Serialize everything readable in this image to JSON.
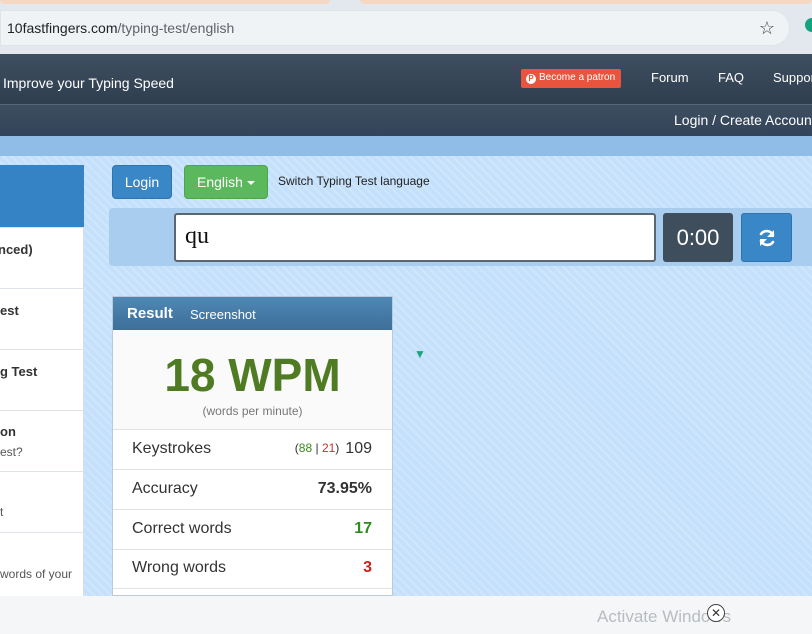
{
  "browser": {
    "url_domain": "10fastfingers.com",
    "url_path": "/typing-test/english",
    "star_icon": "☆"
  },
  "site": {
    "brand": "Improve your Typing Speed",
    "patron_label": "Become a patron",
    "nav": [
      "Forum",
      "FAQ",
      "Suppor"
    ],
    "login_create": "Login / Create Accoun"
  },
  "sidebar": {
    "items": [
      {
        "title": "nced)",
        "sub": ""
      },
      {
        "title": "est",
        "sub": ""
      },
      {
        "title": "g Test",
        "sub": ""
      },
      {
        "title": "on",
        "sub": "est?"
      },
      {
        "title": "",
        "sub": "t"
      },
      {
        "title": "",
        "sub": "words of your"
      }
    ]
  },
  "controls": {
    "login_label": "Login",
    "language_label": "English",
    "switch_text": "Switch Typing Test language",
    "input_value": "qu",
    "timer": "0:00"
  },
  "result": {
    "title": "Result",
    "screenshot": "Screenshot",
    "wpm": "18 WPM",
    "wpm_sub": "(words per minute)",
    "keystrokes_label": "Keystrokes",
    "keystrokes_correct": "88",
    "keystrokes_sep": "|",
    "keystrokes_wrong": "21",
    "keystrokes_total": "109",
    "accuracy_label": "Accuracy",
    "accuracy_value": "73.95%",
    "correct_label": "Correct words",
    "correct_value": "17",
    "wrong_label": "Wrong words",
    "wrong_value": "3"
  },
  "footer": {
    "activate_text": "Activate Windows",
    "close_icon": "✕"
  },
  "colors": {
    "wpm_green": "#4f7b23",
    "login_blue": "#3a87c8",
    "language_green": "#5cb85c",
    "patron_red": "#e8543d"
  }
}
